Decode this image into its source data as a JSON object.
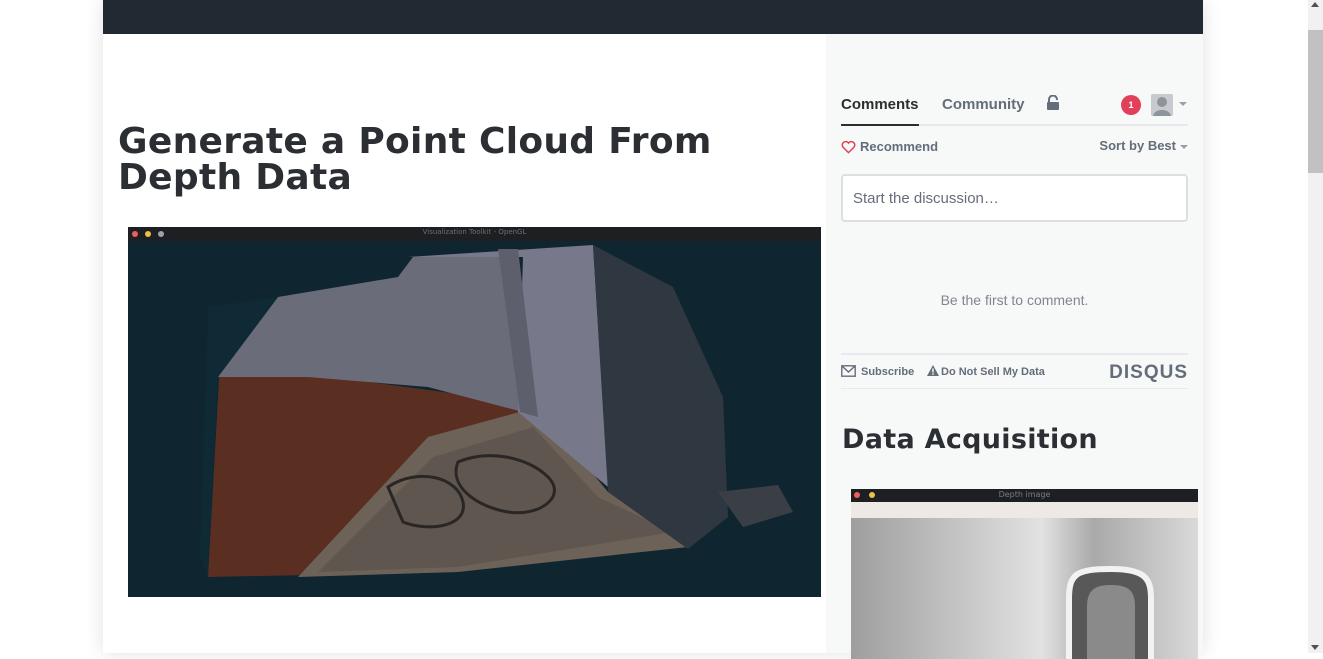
{
  "article": {
    "title": "Generate a Point Cloud From Depth Data",
    "figure1": {
      "window_title": "Visualization Toolkit - OpenGL"
    }
  },
  "disqus": {
    "tabs": [
      {
        "label": "Comments",
        "active": true
      },
      {
        "label": "Community",
        "active": false
      }
    ],
    "notification_count": "1",
    "recommend_label": "Recommend",
    "sort_label": "Sort by Best",
    "input_placeholder": "Start the discussion…",
    "empty_message": "Be the first to comment.",
    "subscribe_label": "Subscribe",
    "do_not_sell_label": "Do Not Sell My Data",
    "brand": "DISQUS"
  },
  "sidebar": {
    "section_title": "Data Acquisition",
    "figure2": {
      "window_title": "Depth image"
    }
  },
  "colors": {
    "topbar": "#212932",
    "notification": "#e2405a",
    "heart": "#e2405a",
    "muted_text": "#656c7a"
  },
  "icons": [
    "lock-icon",
    "avatar-icon",
    "heart-icon",
    "chevron-down-icon",
    "mail-icon",
    "warning-icon"
  ]
}
